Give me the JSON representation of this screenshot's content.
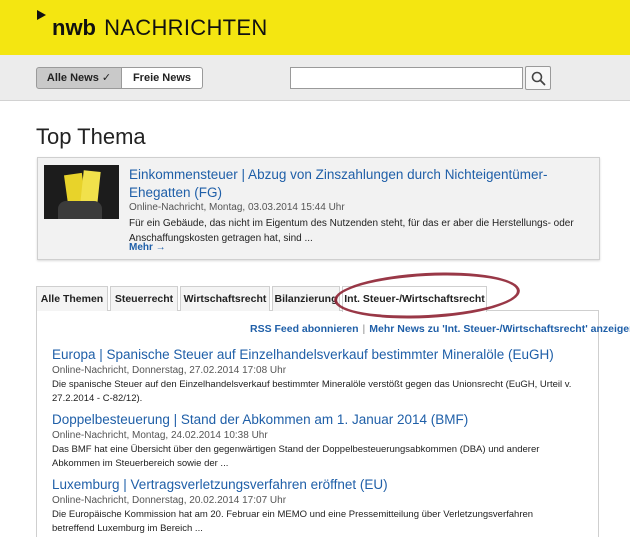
{
  "brand": {
    "name_bold": "nwb",
    "name_rest": "NACHRICHTEN"
  },
  "toolbar": {
    "tab_all": "Alle News ✓",
    "tab_free": "Freie News",
    "search_placeholder": ""
  },
  "page": {
    "title": "Top Thema"
  },
  "feature": {
    "title": "Einkommensteuer | Abzug von Zinszahlungen durch Nichteigentümer-Ehegatten (FG)",
    "meta": "Online-Nachricht, Montag, 03.03.2014 15:44 Uhr",
    "excerpt": "Für ein Gebäude, das nicht im Eigentum des Nutzenden steht, für das er aber die Herstellungs- oder Anschaffungskosten getragen hat, sind ...",
    "more": "Mehr →"
  },
  "tabs": [
    "Alle Themen",
    "Steuerrecht",
    "Wirtschaftsrecht",
    "Bilanzierung",
    "Int. Steuer-/Wirtschaftsrecht"
  ],
  "links": {
    "rss": "RSS Feed abonnieren",
    "more": "Mehr News zu 'Int. Steuer-/Wirtschaftsrecht' anzeigen"
  },
  "articles": [
    {
      "title": "Europa | Spanische Steuer auf Einzelhandelsverkauf bestimmter Mineralöle (EuGH)",
      "meta": "Online-Nachricht, Donnerstag, 27.02.2014 17:08 Uhr",
      "excerpt": "Die spanische Steuer auf den Einzelhandelsverkauf bestimmter Mineralöle verstößt gegen das Unionsrecht (EuGH, Urteil v. 27.2.2014 - C-82/12)."
    },
    {
      "title": "Doppelbesteuerung | Stand der Abkommen am 1. Januar 2014 (BMF)",
      "meta": "Online-Nachricht, Montag, 24.02.2014 10:38 Uhr",
      "excerpt": "Das BMF hat eine Übersicht über den gegenwärtigen Stand der Doppelbesteuerungsabkommen (DBA) und anderer Abkommen im Steuerbereich sowie der ..."
    },
    {
      "title": "Luxemburg | Vertragsverletzungsverfahren eröffnet (EU)",
      "meta": "Online-Nachricht, Donnerstag, 20.02.2014 17:07 Uhr",
      "excerpt": "Die Europäische Kommission hat am 20. Februar ein MEMO und eine Pressemitteilung über Verletzungsverfahren betreffend Luxemburg im Bereich ..."
    }
  ],
  "colors": {
    "header": "#f4e611",
    "link": "#1f5fa8",
    "highlight": "#8e2233"
  }
}
